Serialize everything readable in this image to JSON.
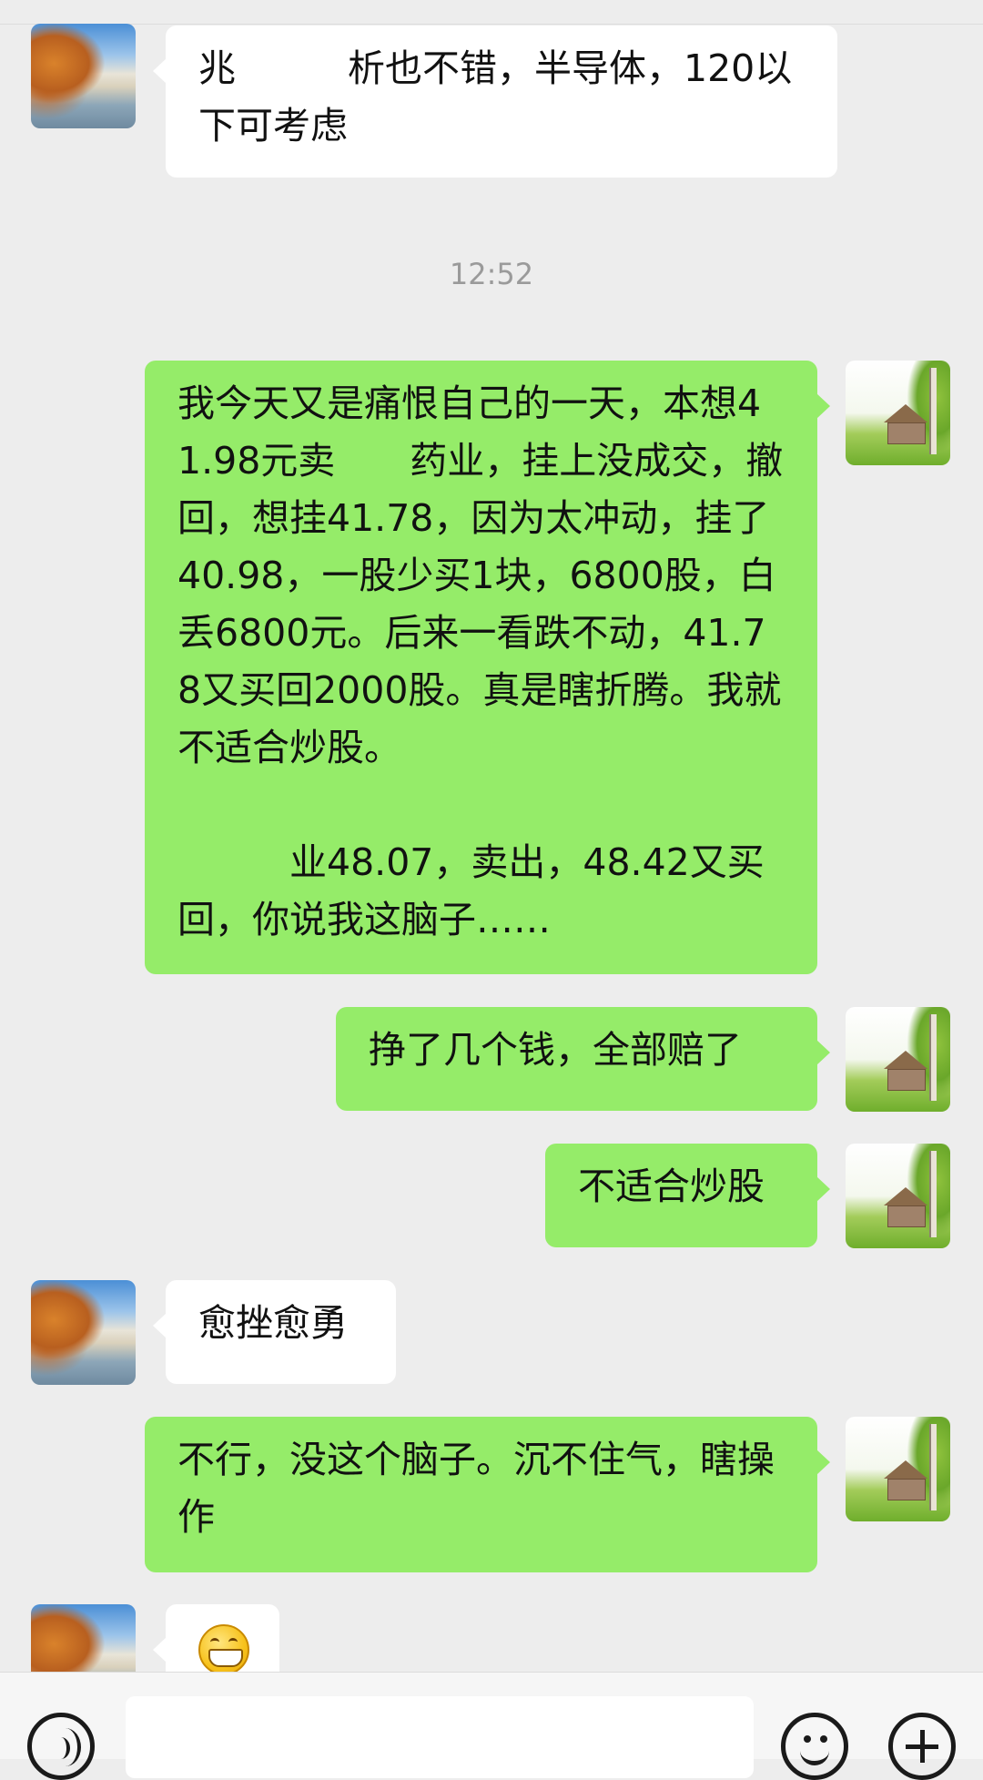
{
  "messages": [
    {
      "side": "in",
      "text": "兆　　　析也不错，半导体，120以下可考虑"
    },
    {
      "time": "12:52"
    },
    {
      "side": "out",
      "text": "我今天又是痛恨自己的一天，本想41.98元卖　　药业，挂上没成交，撤回，想挂41.78，因为太冲动，挂了40.98，一股少买1块，6800股，白丢6800元。后来一看跌不动，41.78又买回2000股。真是瞎折腾。我就不适合炒股。\n\n　　　业48.07，卖出，48.42又买回，你说我这脑子……"
    },
    {
      "side": "out",
      "text": "挣了几个钱，全部赔了"
    },
    {
      "side": "out",
      "text": "不适合炒股"
    },
    {
      "side": "in",
      "text": "愈挫愈勇"
    },
    {
      "side": "out",
      "text": "不行，没这个脑子。沉不住气，瞎操作"
    },
    {
      "side": "in",
      "emoji": "grinning-face-emoji"
    }
  ],
  "avatars": {
    "incoming": "lake-autumn-avatar",
    "outgoing": "cabin-tree-avatar"
  },
  "input_bar": {
    "value": "",
    "icons": [
      "voice-icon",
      "emoji-icon",
      "plus-icon"
    ]
  },
  "colors": {
    "background": "#ededed",
    "incoming_bubble": "#ffffff",
    "outgoing_bubble": "#95ec69",
    "time_text": "#9a9a9a"
  }
}
